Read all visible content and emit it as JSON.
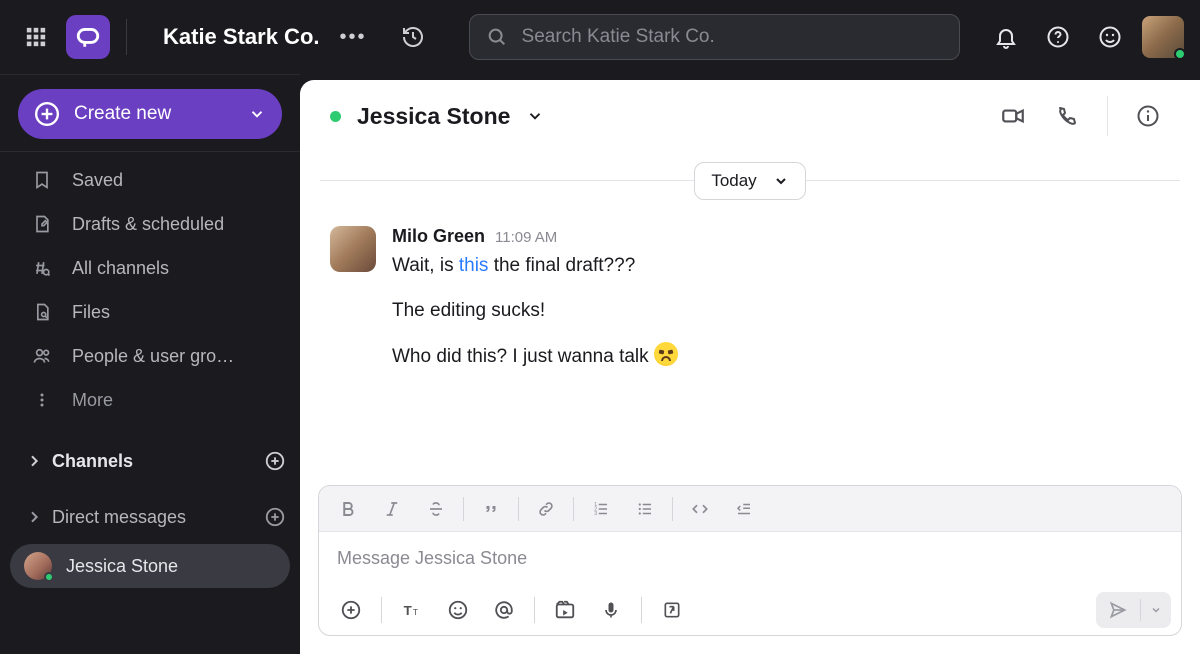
{
  "topbar": {
    "org_name": "Katie Stark Co.",
    "search_placeholder": "Search Katie Stark Co."
  },
  "sidebar": {
    "create_label": "Create new",
    "nav": [
      {
        "label": "Saved"
      },
      {
        "label": "Drafts & scheduled"
      },
      {
        "label": "All channels"
      },
      {
        "label": "Files"
      },
      {
        "label": "People & user gro…"
      }
    ],
    "more_label": "More",
    "channels_header": "Channels",
    "dm_header": "Direct messages",
    "active_dm": "Jessica Stone"
  },
  "conversation": {
    "title": "Jessica Stone",
    "date_label": "Today",
    "message": {
      "author": "Milo Green",
      "time": "11:09 AM",
      "line1_before": "Wait, is ",
      "line1_link": "this",
      "line1_after": " the final draft???",
      "line2": "The editing sucks!",
      "line3": "Who did this? I just wanna talk "
    },
    "composer_placeholder": "Message Jessica Stone"
  }
}
